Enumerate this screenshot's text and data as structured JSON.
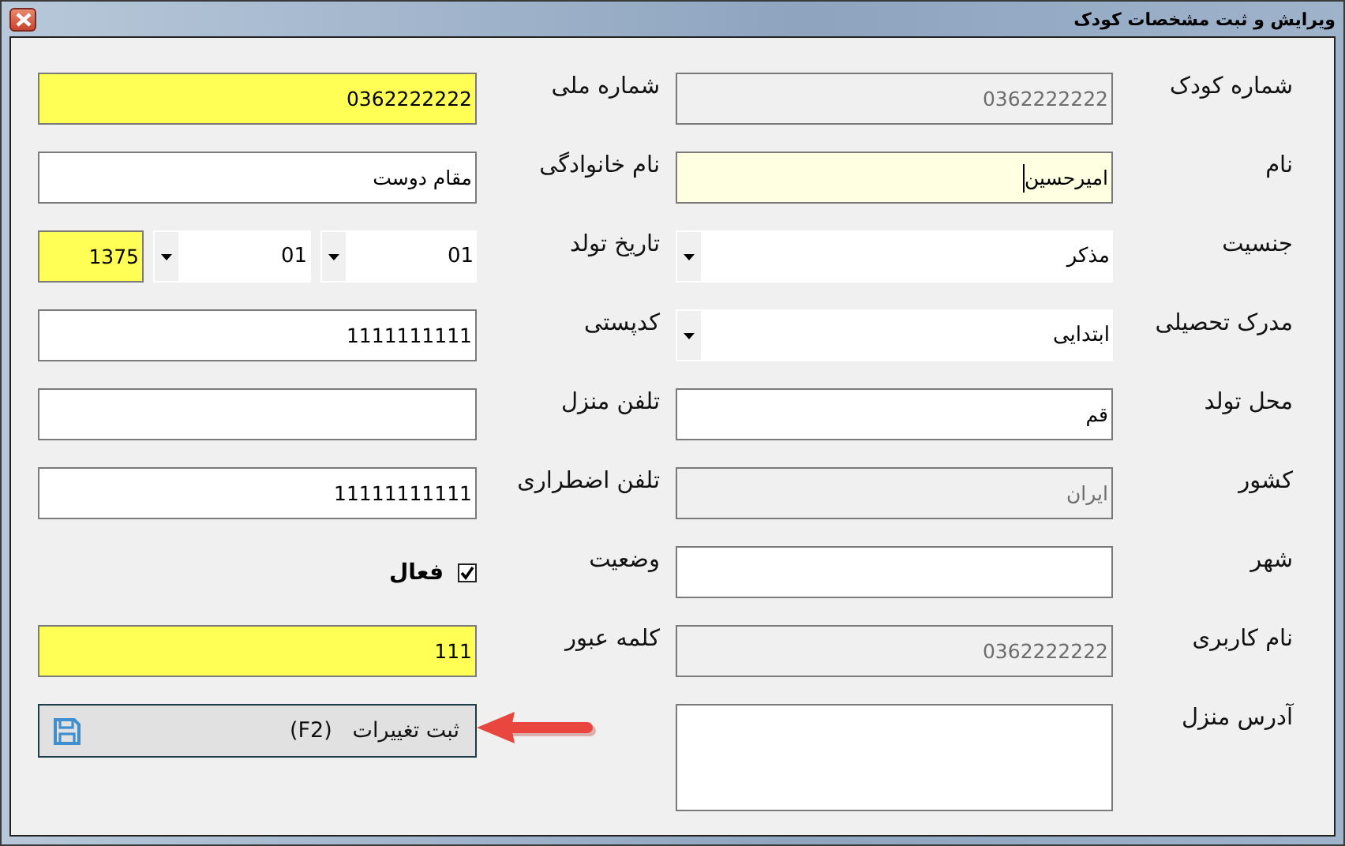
{
  "window": {
    "title": "ویرایش و ثبت مشخصات کودک"
  },
  "right_column": [
    {
      "label": "شماره کودک",
      "kind": "text",
      "value": "0362222222",
      "disabled": true,
      "focused": false
    },
    {
      "label": "نام",
      "kind": "text",
      "value": "امیرحسین",
      "color": "#ffffe1",
      "disabled": false,
      "focused": true
    },
    {
      "label": "جنسیت",
      "kind": "dropdown",
      "value": "مذکر"
    },
    {
      "label": "مدرک تحصیلی",
      "kind": "dropdown",
      "value": "ابتدایی"
    },
    {
      "label": "محل تولد",
      "kind": "text",
      "value": "قم",
      "disabled": false,
      "focused": false
    },
    {
      "label": "کشور",
      "kind": "text",
      "value": "ایران",
      "disabled": true,
      "focused": false
    },
    {
      "label": "شهر",
      "kind": "text",
      "disabled": false,
      "focused": false
    },
    {
      "label": "نام کاربری",
      "kind": "text",
      "value": "0362222222",
      "disabled": true,
      "focused": false
    },
    {
      "label": "آدرس منزل",
      "kind": "textarea"
    }
  ],
  "left_column": [
    {
      "label": "شماره ملی",
      "kind": "text",
      "value": "0362222222",
      "color": "#ffff55",
      "disabled": false,
      "focused": false
    },
    {
      "label": "نام خانوادگی",
      "kind": "text",
      "value": "مقام دوست",
      "disabled": false,
      "focused": false
    },
    {
      "label": "تاریخ تولد",
      "kind": "date",
      "parts": [
        {
          "kind": "dropdown",
          "value": "01"
        },
        {
          "kind": "dropdown",
          "value": "01"
        },
        {
          "kind": "text",
          "value": "1375",
          "color": "#ffff55"
        }
      ]
    },
    {
      "label": "کدپستی",
      "kind": "text",
      "value": "1111111111",
      "disabled": false,
      "focused": false
    },
    {
      "label": "تلفن منزل",
      "kind": "text",
      "disabled": false,
      "focused": false
    },
    {
      "label": "تلفن اضطراری",
      "kind": "text",
      "value": "11111111111",
      "disabled": false,
      "focused": false
    },
    {
      "label": "وضعیت",
      "kind": "checkbox",
      "text": "فعال",
      "checked": true
    },
    {
      "label": "کلمه عبور",
      "kind": "text",
      "value": "111",
      "color": "#ffff55",
      "disabled": false,
      "focused": false
    },
    {
      "kind": "button",
      "text": "ثبت تغییرات   (F2)",
      "annotated": true
    }
  ]
}
